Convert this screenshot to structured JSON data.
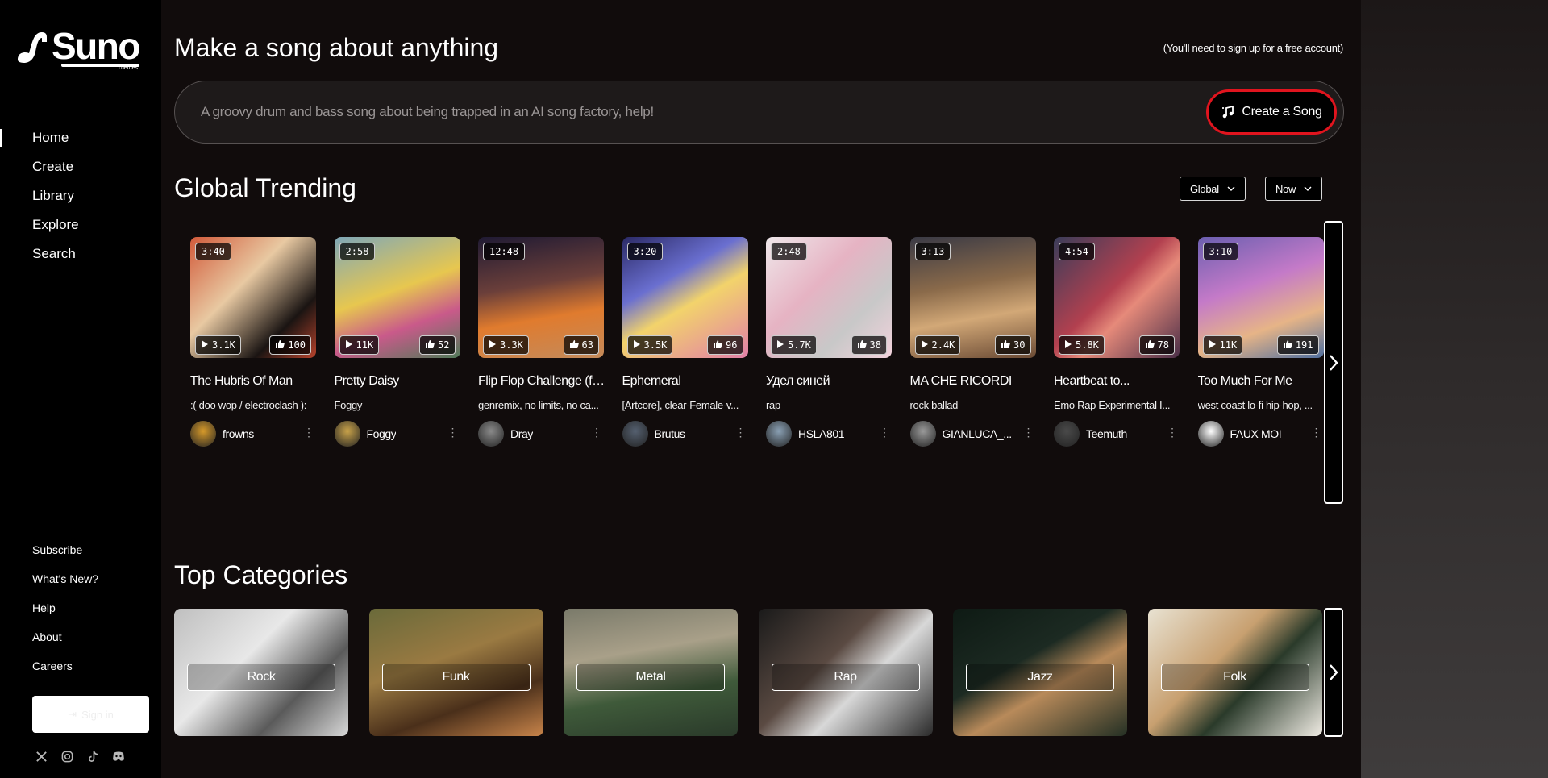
{
  "brand": {
    "name": "Suno",
    "sub": "Themes"
  },
  "nav": [
    {
      "label": "Home",
      "active": true
    },
    {
      "label": "Create"
    },
    {
      "label": "Library"
    },
    {
      "label": "Explore"
    },
    {
      "label": "Search"
    }
  ],
  "footer": [
    "Subscribe",
    "What's New?",
    "Help",
    "About",
    "Careers"
  ],
  "signin": {
    "label": "Sign in"
  },
  "socials": [
    "x-icon",
    "instagram-icon",
    "tiktok-icon",
    "discord-icon"
  ],
  "hero": {
    "title": "Make a song about anything",
    "note": "(You'll need to sign up for a free account)",
    "placeholder": "A groovy drum and bass song about being trapped in an AI song factory, help!",
    "create_label": "Create a Song"
  },
  "trending": {
    "title": "Global Trending",
    "scope": "Global",
    "time": "Now",
    "tracks": [
      {
        "duration": "3:40",
        "plays": "3.1K",
        "likes": "100",
        "title": "The Hubris Of Man",
        "style": ":( doo wop / electroclash ):",
        "user": "frowns",
        "art": "linear-gradient(135deg,#d25a3a 0%,#e8c9a2 40%,#1a1412 75%,#b8432c 100%)",
        "avatar": "#d79a2a"
      },
      {
        "duration": "2:58",
        "plays": "11K",
        "likes": "52",
        "title": "Pretty Daisy",
        "style": "Foggy",
        "user": "Foggy",
        "art": "linear-gradient(160deg,#7fa8b8 0%,#e7c74f 45%,#c95a8a 70%,#4f7a58 100%)",
        "avatar": "#c8a24a"
      },
      {
        "duration": "12:48",
        "plays": "3.3K",
        "likes": "63",
        "title": "Flip Flop Challenge (ft. ...",
        "style": "genremix, no limits, no ca...",
        "user": "Dray",
        "art": "linear-gradient(170deg,#1f1a33 0%,#6b3f3a 40%,#e07b2e 65%,#c48a5a 100%)",
        "avatar": "#8a8a8a"
      },
      {
        "duration": "3:20",
        "plays": "3.5K",
        "likes": "96",
        "title": "Ephemeral",
        "style": "[Artcore], clear-Female-v...",
        "user": "Brutus",
        "art": "linear-gradient(150deg,#2b2a66 0%,#6a6fd0 35%,#f2d36b 55%,#e27fa8 100%)",
        "avatar": "#556070"
      },
      {
        "duration": "2:48",
        "plays": "5.7K",
        "likes": "38",
        "title": "Удел синей",
        "style": "rap",
        "user": "HSLA801",
        "art": "linear-gradient(135deg,#efe7ea 0%,#e6b3c3 40%,#c8c8c8 70%,#f3d2dc 100%)",
        "avatar": "#8aa0b4"
      },
      {
        "duration": "3:13",
        "plays": "2.4K",
        "likes": "30",
        "title": "MA CHE RICORDI",
        "style": "rock ballad",
        "user": "GIANLUCA_...",
        "art": "linear-gradient(170deg,#3a3a45 0%,#8a6a4a 40%,#d2a877 65%,#6a4a34 100%)",
        "avatar": "#9a9a9a"
      },
      {
        "duration": "4:54",
        "plays": "5.8K",
        "likes": "78",
        "title": "Heartbeat to...",
        "style": "Emo Rap Experimental I...",
        "user": "Teemuth",
        "art": "linear-gradient(135deg,#3a3d5a 0%,#b2404f 45%,#e68a7a 60%,#4a2e48 100%)",
        "avatar": "#4a4a4a"
      },
      {
        "duration": "3:10",
        "plays": "11K",
        "likes": "191",
        "title": "Too Much For Me",
        "style": "west coast lo-fi hip-hop, ...",
        "user": "FAUX MOI",
        "art": "linear-gradient(160deg,#6b5fb0 0%,#c47ac8 40%,#e6b487 70%,#4f6fa0 100%)",
        "avatar": "#ffffff"
      }
    ]
  },
  "categories": {
    "title": "Top Categories",
    "items": [
      {
        "label": "Rock",
        "bg": "linear-gradient(135deg,#bfbfbf 0%,#e8e8e8 40%,#5a5a5a 70%,#d8d8d8 100%)"
      },
      {
        "label": "Funk",
        "bg": "linear-gradient(160deg,#6a6a3a 0%,#9a7a42 40%,#4a2f1a 70%,#c8844a 100%)"
      },
      {
        "label": "Metal",
        "bg": "linear-gradient(170deg,#7a7a6a 0%,#a9a089 35%,#3f5a3a 65%,#2a3a2a 100%)"
      },
      {
        "label": "Rap",
        "bg": "linear-gradient(135deg,#1a1a1a 0%,#5a4a42 40%,#d8d8d8 60%,#2a2a2a 100%)"
      },
      {
        "label": "Jazz",
        "bg": "linear-gradient(150deg,#0e1a14 0%,#1c2a22 40%,#b88a5a 60%,#243024 100%)"
      },
      {
        "label": "Folk",
        "bg": "linear-gradient(135deg,#e8e2d2 0%,#c8a070 40%,#2a3a2a 60%,#f0ece4 100%)"
      }
    ]
  },
  "colors": {
    "accent": "#e0141e",
    "main_bg": "#110c0c"
  }
}
